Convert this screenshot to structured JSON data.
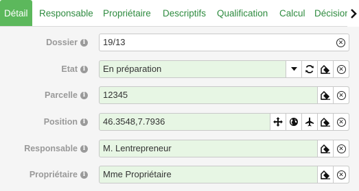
{
  "tabs": [
    {
      "label": "Détail",
      "active": true
    },
    {
      "label": "Responsable"
    },
    {
      "label": "Propriétaire"
    },
    {
      "label": "Descriptifs"
    },
    {
      "label": "Qualification"
    },
    {
      "label": "Calcul"
    },
    {
      "label": "Décision"
    }
  ],
  "fields": {
    "dossier": {
      "label": "Dossier",
      "value": "19/13"
    },
    "etat": {
      "label": "Etat",
      "value": "En préparation"
    },
    "parcelle": {
      "label": "Parcelle",
      "value": "12345"
    },
    "position": {
      "label": "Position",
      "value": "46.3548,7.7936"
    },
    "responsable": {
      "label": "Responsable",
      "value": "M. Lentrepreneur"
    },
    "proprietaire": {
      "label": "Propriétaire",
      "value": "Mme Propriétaire"
    }
  },
  "colors": {
    "accent": "#5cb85c",
    "tab_text": "#2e8b3f",
    "field_bg": "#e7f6e4"
  }
}
